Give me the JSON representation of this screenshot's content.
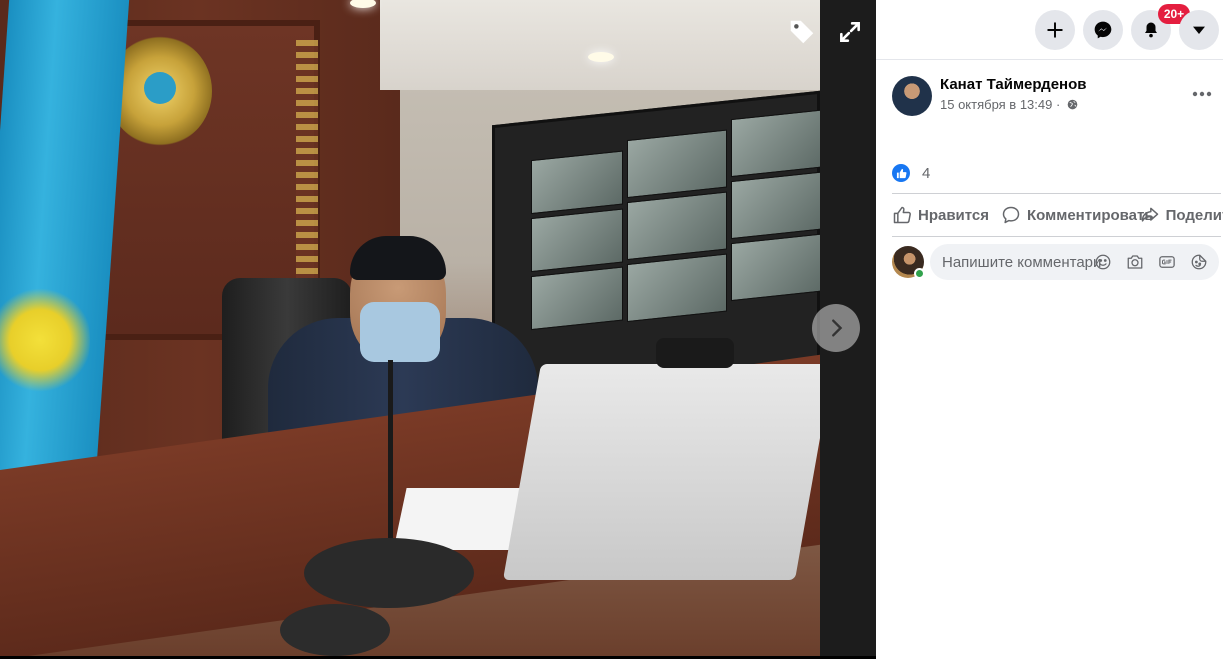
{
  "photo_viewer": {
    "description_icons": [
      "tag-icon",
      "expand-icon",
      "chevron-right-icon"
    ]
  },
  "topbar": {
    "notification_badge": "20+",
    "icons": [
      "plus-icon",
      "messenger-icon",
      "bell-icon",
      "caret-down-icon"
    ]
  },
  "post": {
    "author": "Канат Таймерденов",
    "date": "15 октября в 13:49 ·",
    "privacy_icon": "globe-icon",
    "reaction_count": "4"
  },
  "actions": {
    "like": "Нравится",
    "comment": "Комментировать",
    "share": "Поделиться"
  },
  "comment_input": {
    "placeholder": "Напишите комментарий...",
    "tools": [
      "emoji-icon",
      "camera-icon",
      "gif-icon",
      "sticker-icon"
    ]
  },
  "colors": {
    "brand": "#1877f2",
    "badge": "#e41e3f",
    "online": "#31a24c",
    "secondary_text": "#65676b"
  }
}
